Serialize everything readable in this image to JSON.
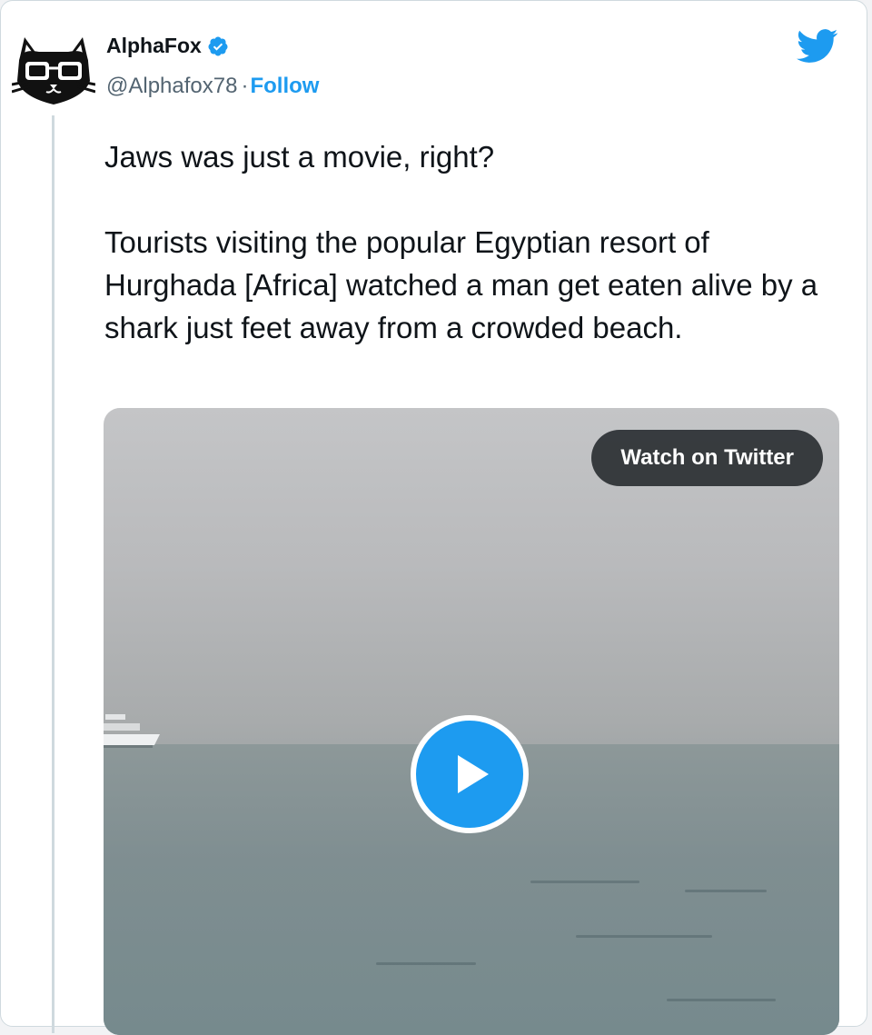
{
  "author": {
    "name": "AlphaFox",
    "handle": "@Alphafox78",
    "separator": "·",
    "follow_label": "Follow",
    "avatar_icon": "cat-with-glasses-avatar",
    "verified_icon": "verified-badge-icon"
  },
  "brand": {
    "logo_icon": "twitter-bird-icon",
    "accent_color": "#1d9bf0"
  },
  "tweet": {
    "line1": "Jaws was just a movie, right?",
    "line2": "Tourists visiting the popular Egyptian resort of Hurghada [Africa] watched a man get eaten alive by a shark just feet away from a crowded beach."
  },
  "media": {
    "type": "video",
    "watch_label": "Watch on Twitter",
    "play_icon": "play-icon"
  }
}
